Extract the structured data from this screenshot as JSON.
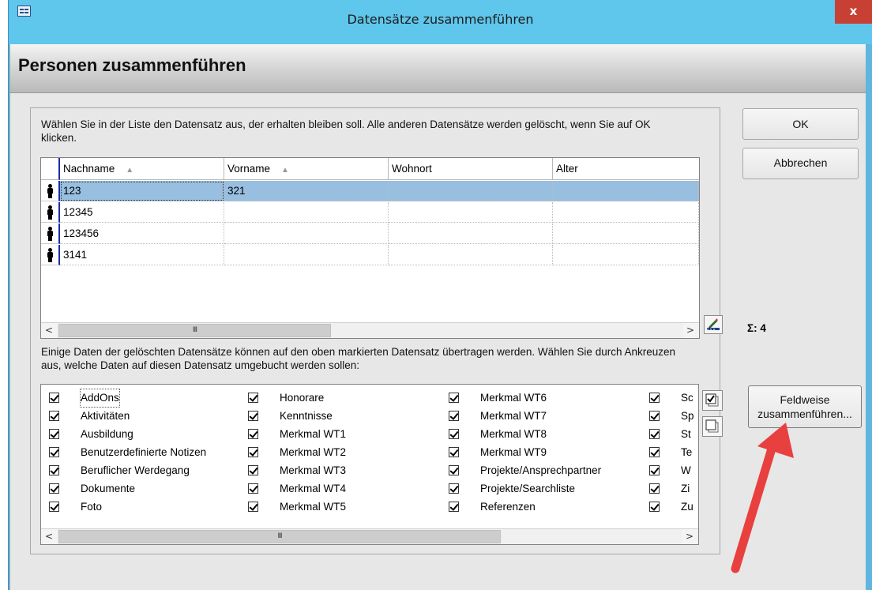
{
  "window": {
    "title": "Datensätze zusammenführen",
    "close_label": "x"
  },
  "form": {
    "title": "Personen zusammenführen",
    "instruction_top": "Wählen Sie in der Liste den Datensatz aus, der erhalten bleiben soll. Alle anderen Datensätze werden gelöscht, wenn Sie auf OK klicken.",
    "instruction_bottom": "Einige Daten der gelöschten Datensätze können auf den oben markierten Datensatz übertragen werden. Wählen Sie durch Ankreuzen aus, welche Daten auf diesen Datensatz umgebucht werden sollen:",
    "record_count": "Σ: 4"
  },
  "grid": {
    "columns": [
      "Nachname",
      "Vorname",
      "Wohnort",
      "Alter"
    ],
    "sort_indicator": "▲",
    "rows": [
      {
        "nachname": "123",
        "vorname": "321",
        "wohnort": "",
        "alter": "",
        "selected": true
      },
      {
        "nachname": "12345",
        "vorname": "",
        "wohnort": "",
        "alter": "",
        "selected": false
      },
      {
        "nachname": "123456",
        "vorname": "",
        "wohnort": "",
        "alter": "",
        "selected": false
      },
      {
        "nachname": "3141",
        "vorname": "",
        "wohnort": "",
        "alter": "",
        "selected": false
      }
    ],
    "scroll_left": "<",
    "scroll_right": ">",
    "scroll_grip": "III"
  },
  "checklist": {
    "columns": [
      [
        "AddOns",
        "Aktivitäten",
        "Ausbildung",
        "Benutzerdefinierte Notizen",
        "Beruflicher Werdegang",
        "Dokumente",
        "Foto"
      ],
      [
        "Honorare",
        "Kenntnisse",
        "Merkmal WT1",
        "Merkmal WT2",
        "Merkmal WT3",
        "Merkmal WT4",
        "Merkmal WT5"
      ],
      [
        "Merkmal WT6",
        "Merkmal WT7",
        "Merkmal WT8",
        "Merkmal WT9",
        "Projekte/Ansprechpartner",
        "Projekte/Searchliste",
        "Referenzen"
      ],
      [
        "Sc",
        "Sp",
        "St",
        "Te",
        "W",
        "Zi",
        "Zu"
      ]
    ],
    "scroll_left": "<",
    "scroll_right": ">",
    "scroll_grip": "III"
  },
  "buttons": {
    "ok": "OK",
    "cancel": "Abbrechen",
    "fieldwise_line1": "Feldweise",
    "fieldwise_line2": "zusammenführen..."
  },
  "colors": {
    "titlebar": "#5fc6ec",
    "selected_row": "#99bfe0",
    "close": "#c84034",
    "annotation_arrow": "#e8403f"
  }
}
